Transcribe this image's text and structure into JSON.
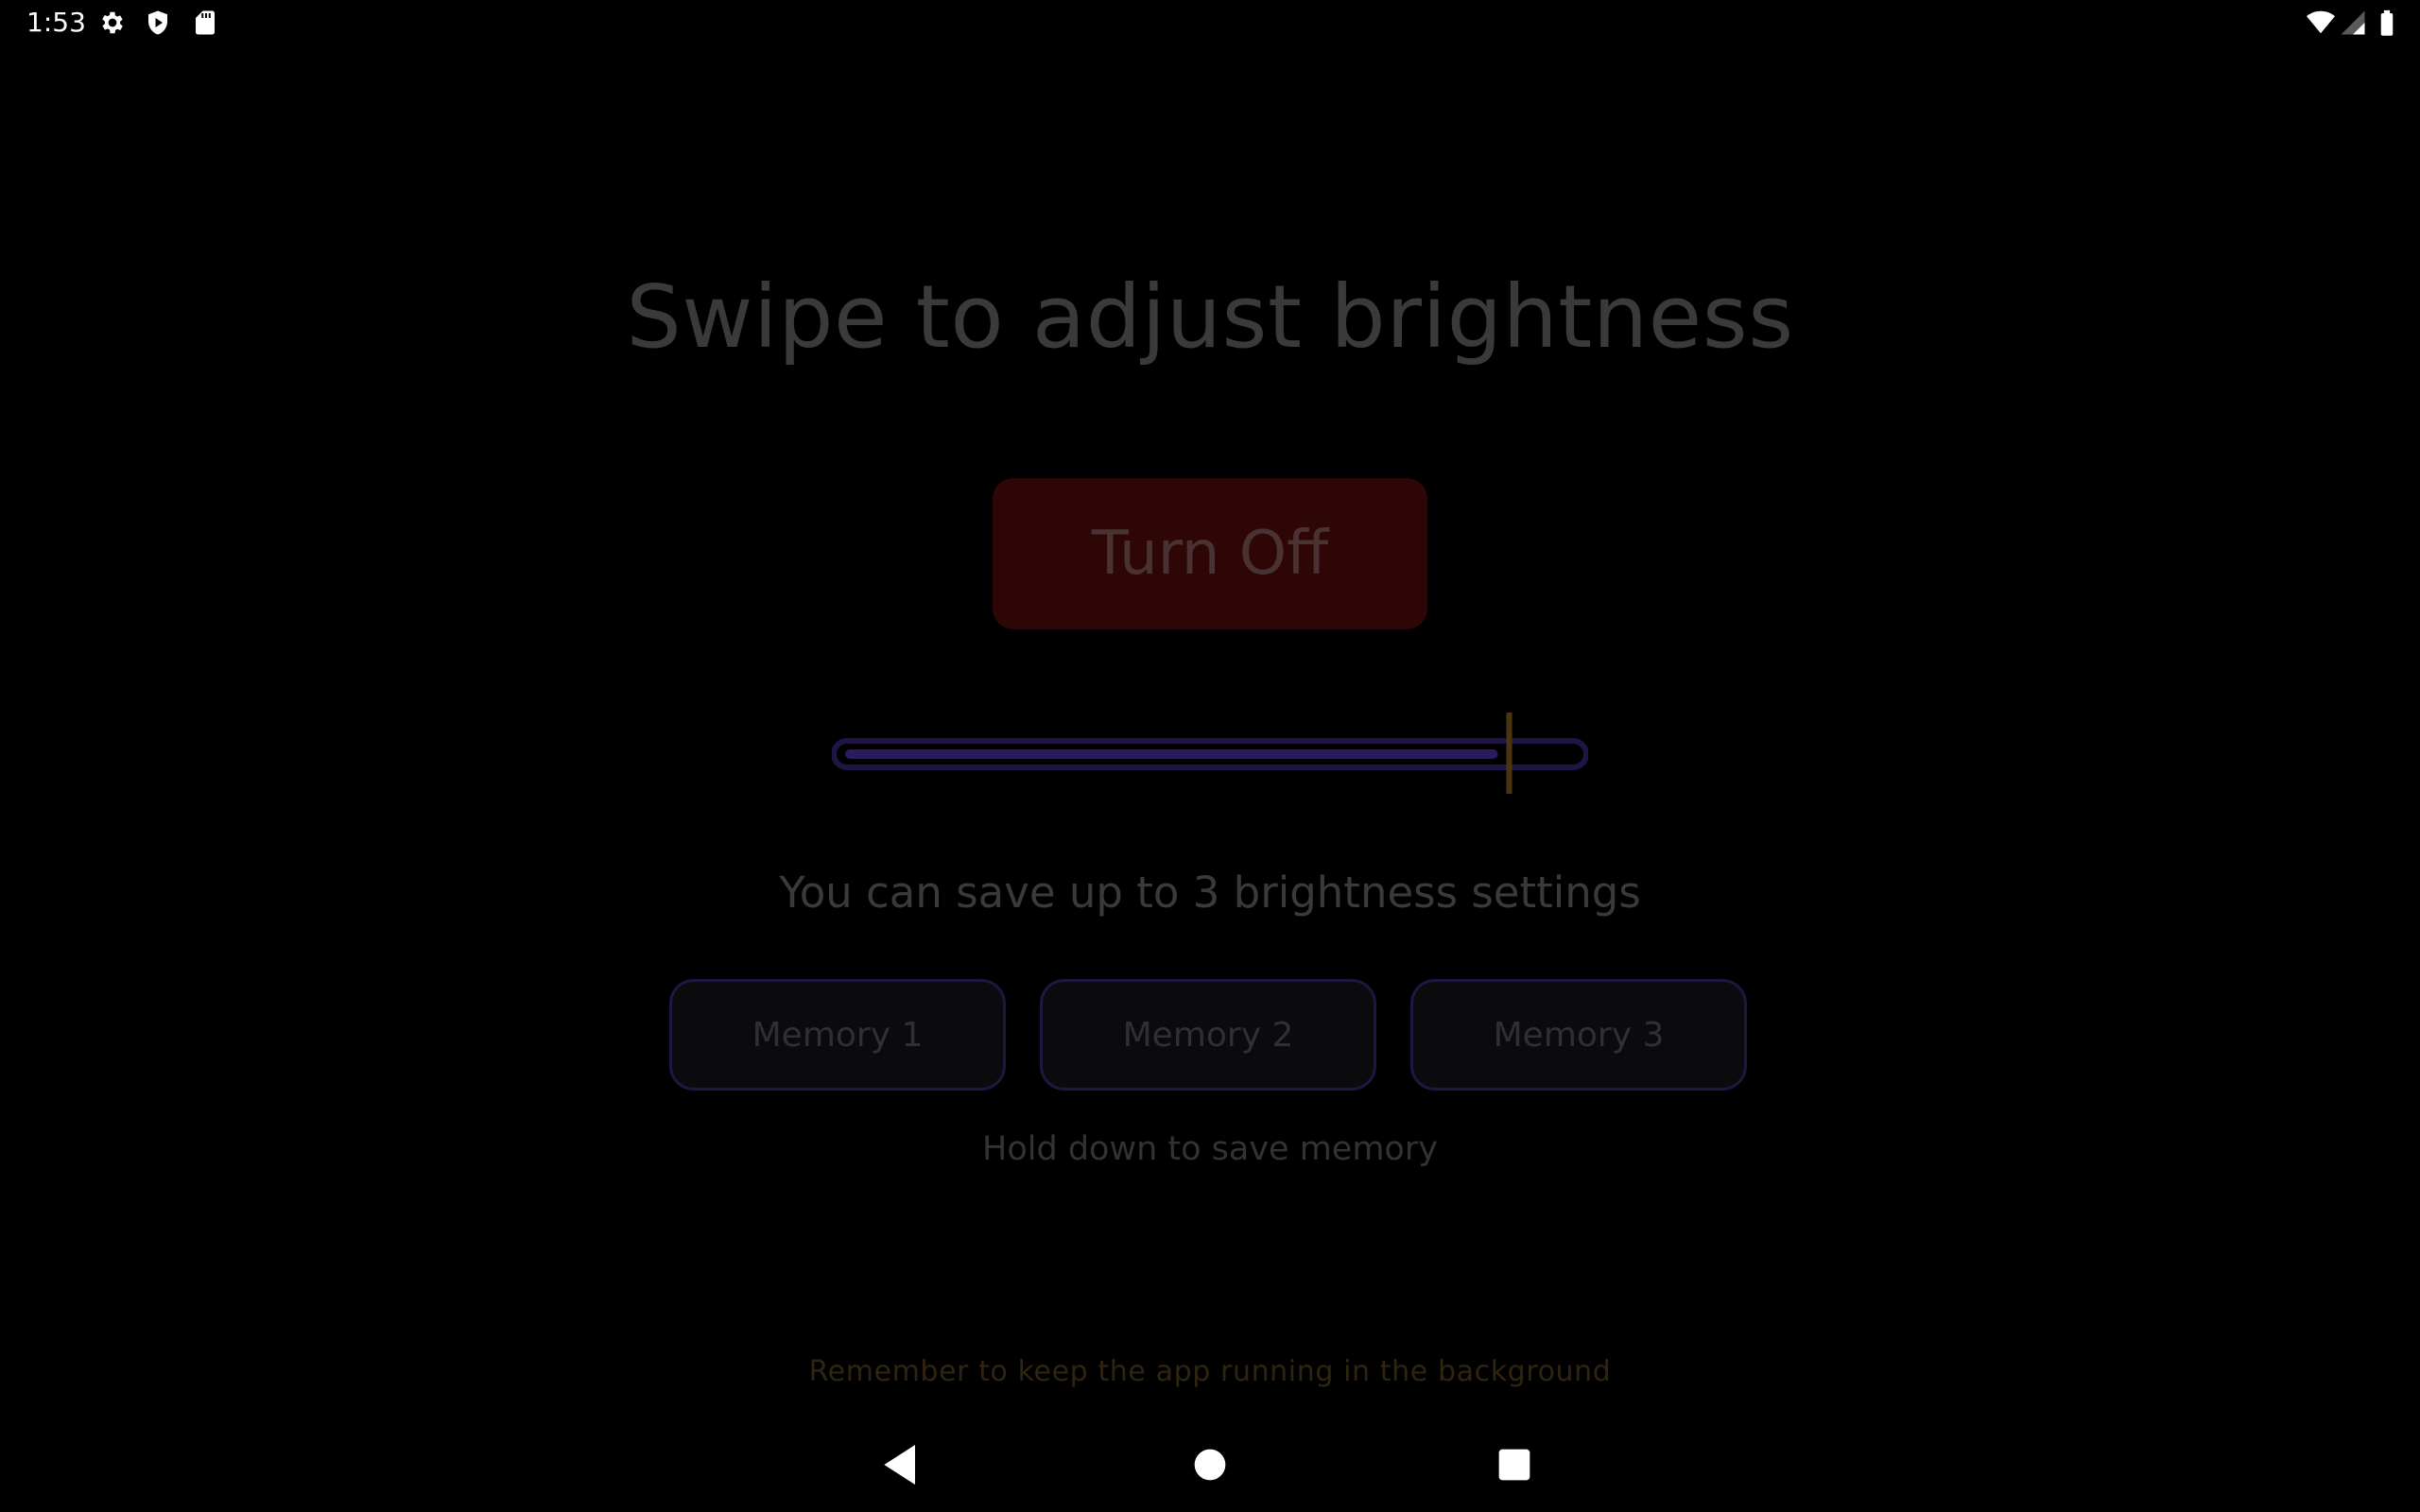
{
  "status_bar": {
    "time": "1:53",
    "left_icons": [
      "gear-icon",
      "shield-icon",
      "sd-card-icon"
    ],
    "right_icons": [
      "wifi-icon",
      "cellular-signal-icon",
      "battery-icon"
    ]
  },
  "main": {
    "title": "Swipe to adjust brightness",
    "turn_off_label": "Turn Off",
    "brightness_slider": {
      "value_fraction": 0.91
    },
    "save_info": "You can save up to 3 brightness settings",
    "memory_buttons": [
      {
        "label": "Memory 1"
      },
      {
        "label": "Memory 2"
      },
      {
        "label": "Memory 3"
      }
    ],
    "hold_hint": "Hold down to save memory",
    "footer_note": "Remember to keep the app running in the background"
  },
  "nav_bar": {
    "buttons": [
      "back-icon",
      "home-icon",
      "recents-icon"
    ]
  },
  "colors": {
    "background": "#000000",
    "turn_off_bg": "#2e0606",
    "slider_track": "#2a1c5c",
    "slider_thumb": "#4a3510",
    "memory_border": "#1e1740",
    "footer_text": "#2f2410"
  }
}
